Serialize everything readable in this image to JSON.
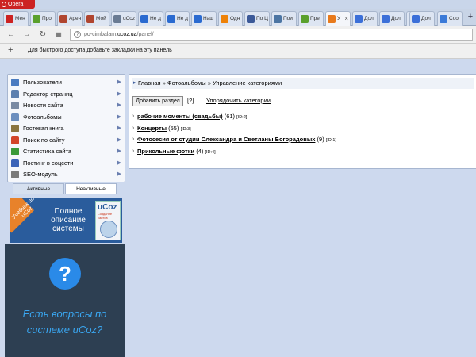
{
  "browser": {
    "menu_label": "Opera",
    "tabs": [
      {
        "label": "Мен",
        "favicon": "opera-icon",
        "color": "#cc2222"
      },
      {
        "label": "Прог",
        "favicon": "green-page-icon",
        "color": "#5aa02c"
      },
      {
        "label": "Арен",
        "favicon": "ova-icon",
        "color": "#b0452f"
      },
      {
        "label": "Мой",
        "favicon": "ova-icon",
        "color": "#b0452f"
      },
      {
        "label": "uCoz",
        "favicon": "ucoz-icon",
        "color": "#6a7b93"
      },
      {
        "label": "Не д",
        "favicon": "u-icon",
        "color": "#2a6ad0"
      },
      {
        "label": "Не д",
        "favicon": "u-icon",
        "color": "#2a6ad0"
      },
      {
        "label": "Наш",
        "favicon": "u-icon",
        "color": "#2a6ad0"
      },
      {
        "label": "Одн",
        "favicon": "odnoklassniki-icon",
        "color": "#ee8208"
      },
      {
        "label": "По Ц",
        "favicon": "facebook-icon",
        "color": "#3b5998"
      },
      {
        "label": "Пои",
        "favicon": "vk-icon",
        "color": "#4c75a3"
      },
      {
        "label": "Пре",
        "favicon": "green-page-icon",
        "color": "#5aa02c"
      },
      {
        "label": "У",
        "favicon": "u-icon",
        "color": "#e87a1c"
      },
      {
        "label": "Дол",
        "favicon": "diamond-icon",
        "color": "#3b6fd8"
      },
      {
        "label": "Дол",
        "favicon": "diamond-icon",
        "color": "#3b6fd8"
      },
      {
        "label": "Дол",
        "favicon": "diamond-icon",
        "color": "#3b6fd8"
      },
      {
        "label": "Дол",
        "favicon": "diamond-icon",
        "color": "#3b6fd8"
      },
      {
        "label": "Соо",
        "favicon": "globe-icon",
        "color": "#3b7ad8"
      }
    ],
    "url_host": "po-cimbalam.",
    "url_domain": "ucoz.ua",
    "url_path": "/panel/",
    "bookmarks_hint": "Для быстрого доступа добавьте закладки на эту панель"
  },
  "sidebar": {
    "items": [
      {
        "label": "Пользователи",
        "icon": "users-icon",
        "color": "#4a7bc0"
      },
      {
        "label": "Редактор страниц",
        "icon": "page-editor-icon",
        "color": "#5c7fae"
      },
      {
        "label": "Новости сайта",
        "icon": "news-icon",
        "color": "#7a8aa3"
      },
      {
        "label": "Фотоальбомы",
        "icon": "photo-album-icon",
        "color": "#6c8fbf"
      },
      {
        "label": "Гостевая книга",
        "icon": "guestbook-icon",
        "color": "#8a7540"
      },
      {
        "label": "Поиск по сайту",
        "icon": "search-icon",
        "color": "#d2452a"
      },
      {
        "label": "Статистика сайта",
        "icon": "statistics-icon",
        "color": "#3a9a3a"
      },
      {
        "label": "Постинг в соцсети",
        "icon": "share-icon",
        "color": "#3a63b8"
      },
      {
        "label": "SEO-модуль",
        "icon": "seo-icon",
        "color": "#7a7a7a"
      }
    ],
    "tab_active": "Активные",
    "tab_inactive": "Неактивные"
  },
  "banners": {
    "promo_ribbon": "Учебник по uCoz",
    "promo_title": "Полное описание системы",
    "promo_box_logo": "uCoz",
    "promo_box_caption": "Создание сайтов",
    "help_symbol": "?",
    "help_text": "Есть вопросы по системе uCoz?"
  },
  "breadcrumb": {
    "home": "Главная",
    "sep": "»",
    "section": "Фотоальбомы",
    "current": "Управление категориями"
  },
  "toolbar": {
    "add_label": "Добавить раздел",
    "help_label": "[?]",
    "sort_label": "Упорядочить категории"
  },
  "categories": [
    {
      "name": "рабочие моменты (свадьбы)",
      "count": "(61)",
      "id": "[ID:2]"
    },
    {
      "name": "Концерты",
      "count": "(55)",
      "id": "[ID:3]"
    },
    {
      "name": "Фотосесия от студии Олександра и Светланы Богорадовых",
      "count": "(9)",
      "id": "[ID:1]"
    },
    {
      "name": "Прикольные фотки",
      "count": "(4)",
      "id": "[ID:4]"
    }
  ]
}
